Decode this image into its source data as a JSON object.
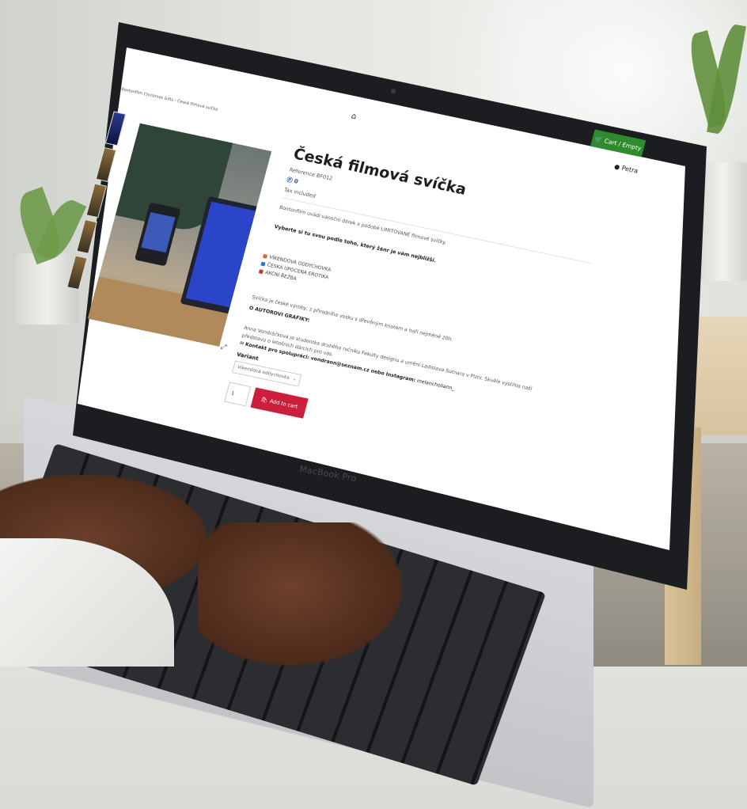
{
  "breadcrumb": "Bontonfilm Christmas Gifts  ›  Česká filmová svíčka",
  "header": {
    "cart_label": "Cart / Empty",
    "user_name": "Petra"
  },
  "product": {
    "title": "Česká filmová svíčka",
    "reference": "Reference BF012",
    "points": "0",
    "tax": "Tax included",
    "intro": "Bontonfilm uvádí vánoční dárek v podobě LIMITOVANÉ filmové svíčky.",
    "choose": "Vyberte si tu svou podle toho, který žánr je vám nejbližší.",
    "genres": [
      {
        "label": "VÍKENDOVÁ ODDYCHOVKA",
        "color": "#d9652b"
      },
      {
        "label": "ČESKÁ UPOCENÁ EROTIKA",
        "color": "#2f6fd1"
      },
      {
        "label": "AKČNÍ ŘEŽBA",
        "color": "#d1332f"
      }
    ],
    "made": "Svíčka je české výroby, z přírodního vosku s dřevěným knotem a hoří nejméně 20h.",
    "author_heading": "O AUTOROVI GRAFIKY:",
    "author_text1": "Anna Vondráčková je studentka druhého ročníku Fakulty designu a umění Ladislava Sutnara v Plzni. Skvěle vystihla naši",
    "author_text2": "představu o letošních dárcích pro vás.",
    "contact_label": "Kontakt pro spolupráci: vondrann@seznam.cz nebo Instagram:",
    "contact_handle": " melancholiann_",
    "variant_label": "Variant",
    "variant_value": "Víkendová oddychovka",
    "quantity": "1",
    "add_to_cart": "Add to cart"
  },
  "device_brand": "MacBook Pro"
}
